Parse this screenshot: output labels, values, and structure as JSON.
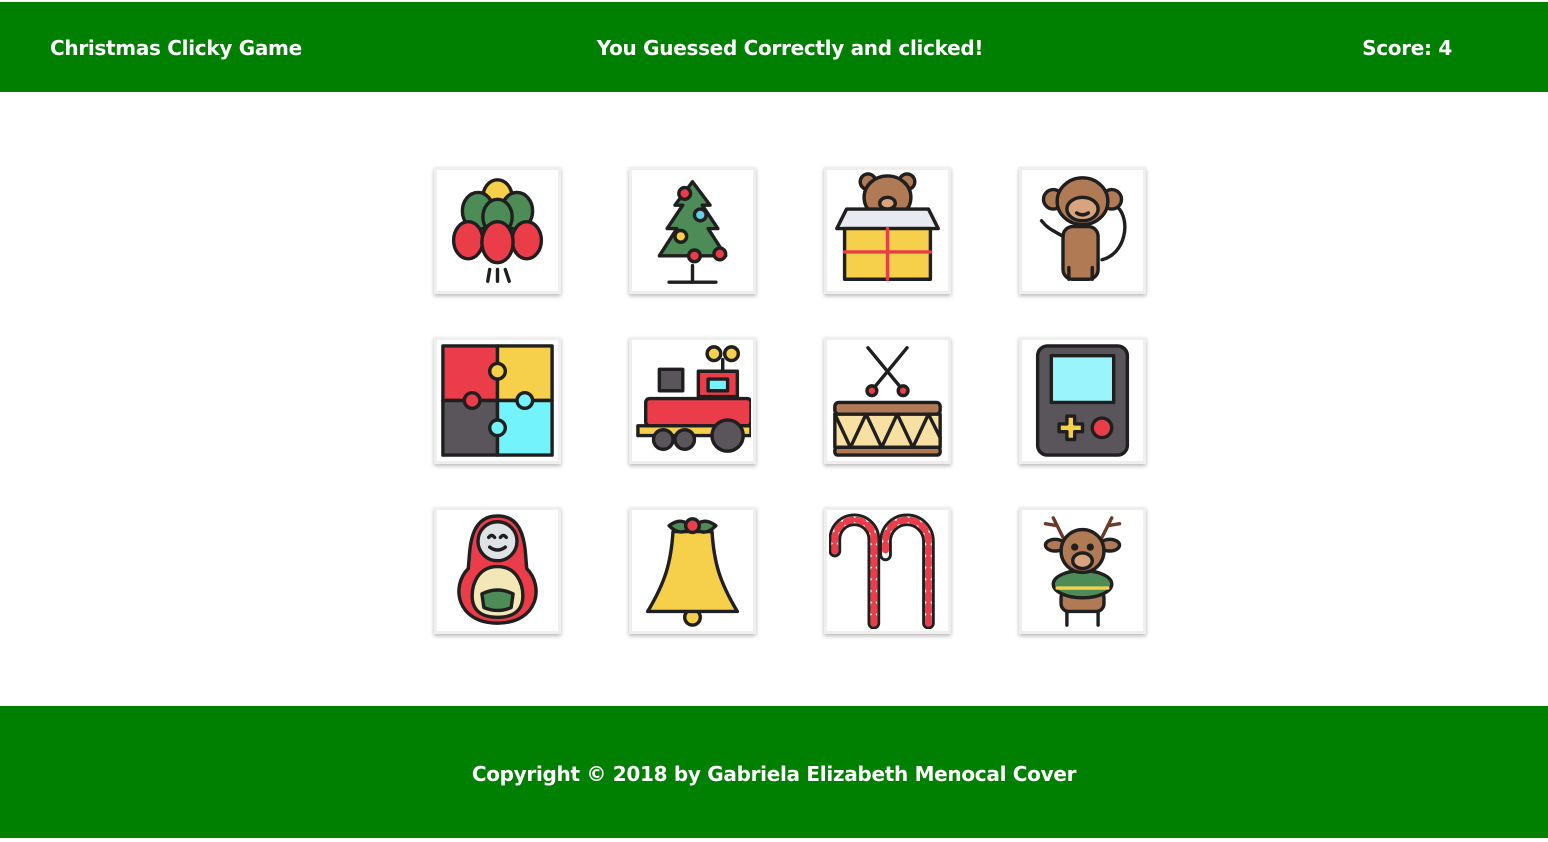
{
  "header": {
    "title": "Christmas Clicky Game",
    "message": "You Guessed Correctly and clicked!",
    "score": "Score: 4"
  },
  "cards": [
    {
      "icon": "balloons-icon"
    },
    {
      "icon": "christmas-tree-icon"
    },
    {
      "icon": "teddy-bear-gift-box-icon"
    },
    {
      "icon": "monkey-toy-icon"
    },
    {
      "icon": "puzzle-icon"
    },
    {
      "icon": "toy-train-icon"
    },
    {
      "icon": "drum-icon"
    },
    {
      "icon": "handheld-game-console-icon"
    },
    {
      "icon": "matryoshka-doll-icon"
    },
    {
      "icon": "bell-icon"
    },
    {
      "icon": "candy-canes-icon"
    },
    {
      "icon": "reindeer-toy-icon"
    }
  ],
  "footer": {
    "copyright": "Copyright © 2018 by Gabriela Elizabeth Menocal Cover"
  },
  "colors": {
    "nav_background": "#008000",
    "text": "#ffffff",
    "page_background": "#ffffff"
  }
}
